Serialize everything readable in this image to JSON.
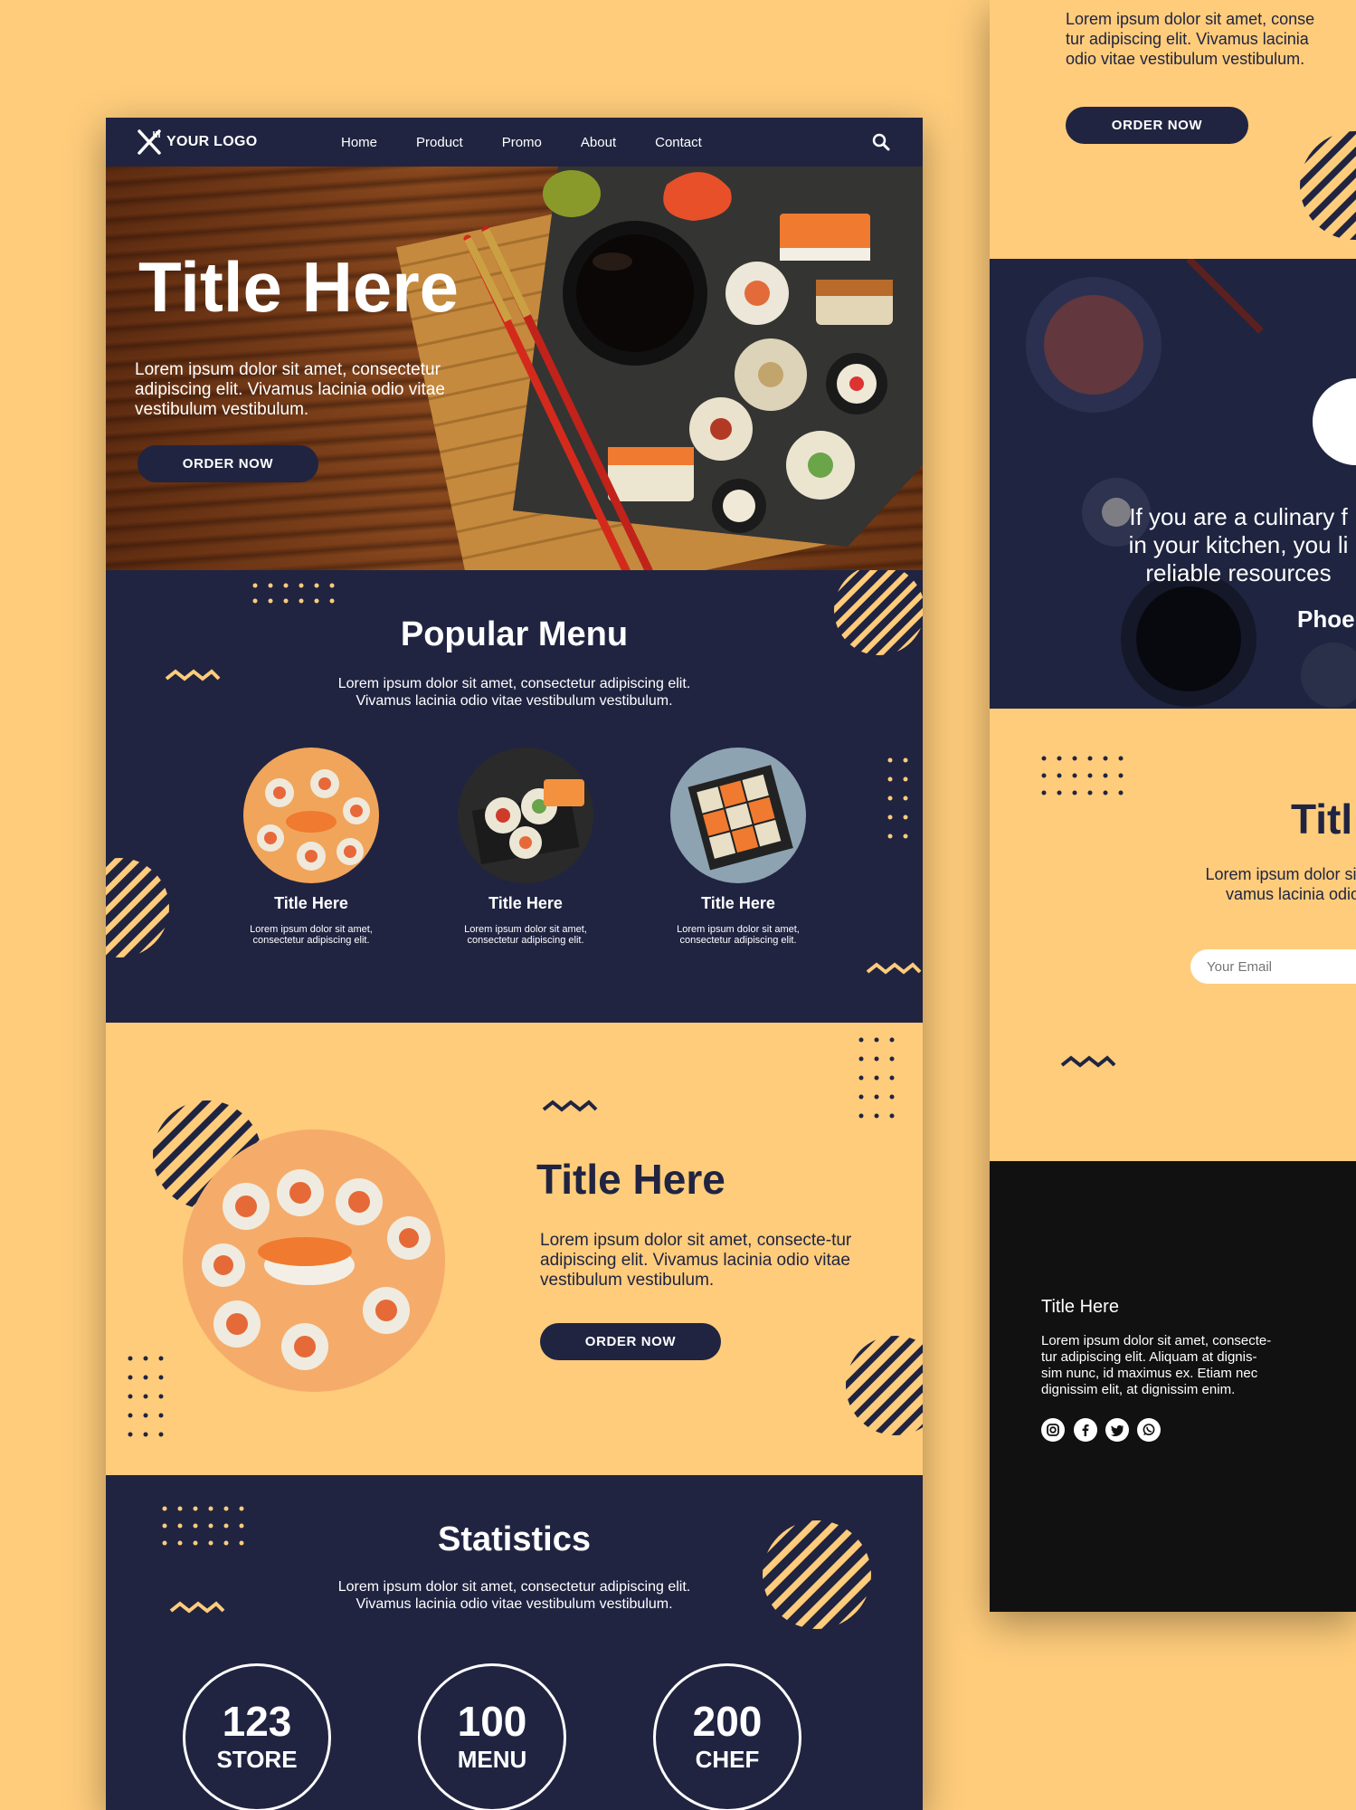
{
  "nav": {
    "logo_text": "YOUR LOGO",
    "items": [
      "Home",
      "Product",
      "Promo",
      "About",
      "Contact"
    ]
  },
  "hero": {
    "title": "Title Here",
    "text": "Lorem ipsum dolor sit amet, consectetur adipiscing elit. Vivamus lacinia odio vitae vestibulum vestibulum.",
    "button": "ORDER NOW"
  },
  "popular": {
    "title": "Popular Menu",
    "subtitle": "Lorem ipsum dolor sit amet, consectetur adipiscing elit.\nVivamus lacinia odio vitae vestibulum vestibulum.",
    "items": [
      {
        "title": "Title Here",
        "desc": "Lorem ipsum dolor sit amet,\nconsectetur adipiscing elit."
      },
      {
        "title": "Title Here",
        "desc": "Lorem ipsum dolor sit amet,\nconsectetur adipiscing elit."
      },
      {
        "title": "Title Here",
        "desc": "Lorem ipsum dolor sit amet,\nconsectetur adipiscing elit."
      }
    ]
  },
  "feature": {
    "title": "Title Here",
    "text": "Lorem ipsum dolor sit amet, consecte-tur adipiscing elit. Vivamus lacinia odio vitae vestibulum vestibulum.",
    "button": "ORDER NOW"
  },
  "statistics": {
    "title": "Statistics",
    "subtitle": "Lorem ipsum dolor sit amet, consectetur adipiscing elit.\nVivamus lacinia odio vitae vestibulum vestibulum.",
    "items": [
      {
        "number": "123",
        "label": "STORE"
      },
      {
        "number": "100",
        "label": "MENU"
      },
      {
        "number": "200",
        "label": "CHEF"
      }
    ]
  },
  "side": {
    "top_text": "Lorem ipsum dolor sit amet, conse\ntur adipiscing elit. Vivamus lacinia\nodio vitae vestibulum vestibulum.",
    "top_button": "ORDER NOW",
    "quote": "If you are a culinary f\nin your kitchen, you li\nreliable resources",
    "quote_author": "Phoe",
    "newsletter_title": "Titl",
    "newsletter_text": "Lorem ipsum dolor sit ar\nvamus lacinia odio",
    "email_placeholder": "Your Email",
    "footer_title": "Title Here",
    "footer_text": "Lorem ipsum dolor sit amet, consecte-\ntur adipiscing elit. Aliquam at dignis-\nsim nunc, id maximus ex. Etiam nec\ndignissim elit, at dignissim enim.",
    "social_icons": [
      "instagram-icon",
      "facebook-icon",
      "twitter-icon",
      "whatsapp-icon"
    ]
  },
  "colors": {
    "navy": "#202441",
    "peach": "#fecc7b",
    "footer": "#111111",
    "accent_red": "#d42a1c"
  }
}
